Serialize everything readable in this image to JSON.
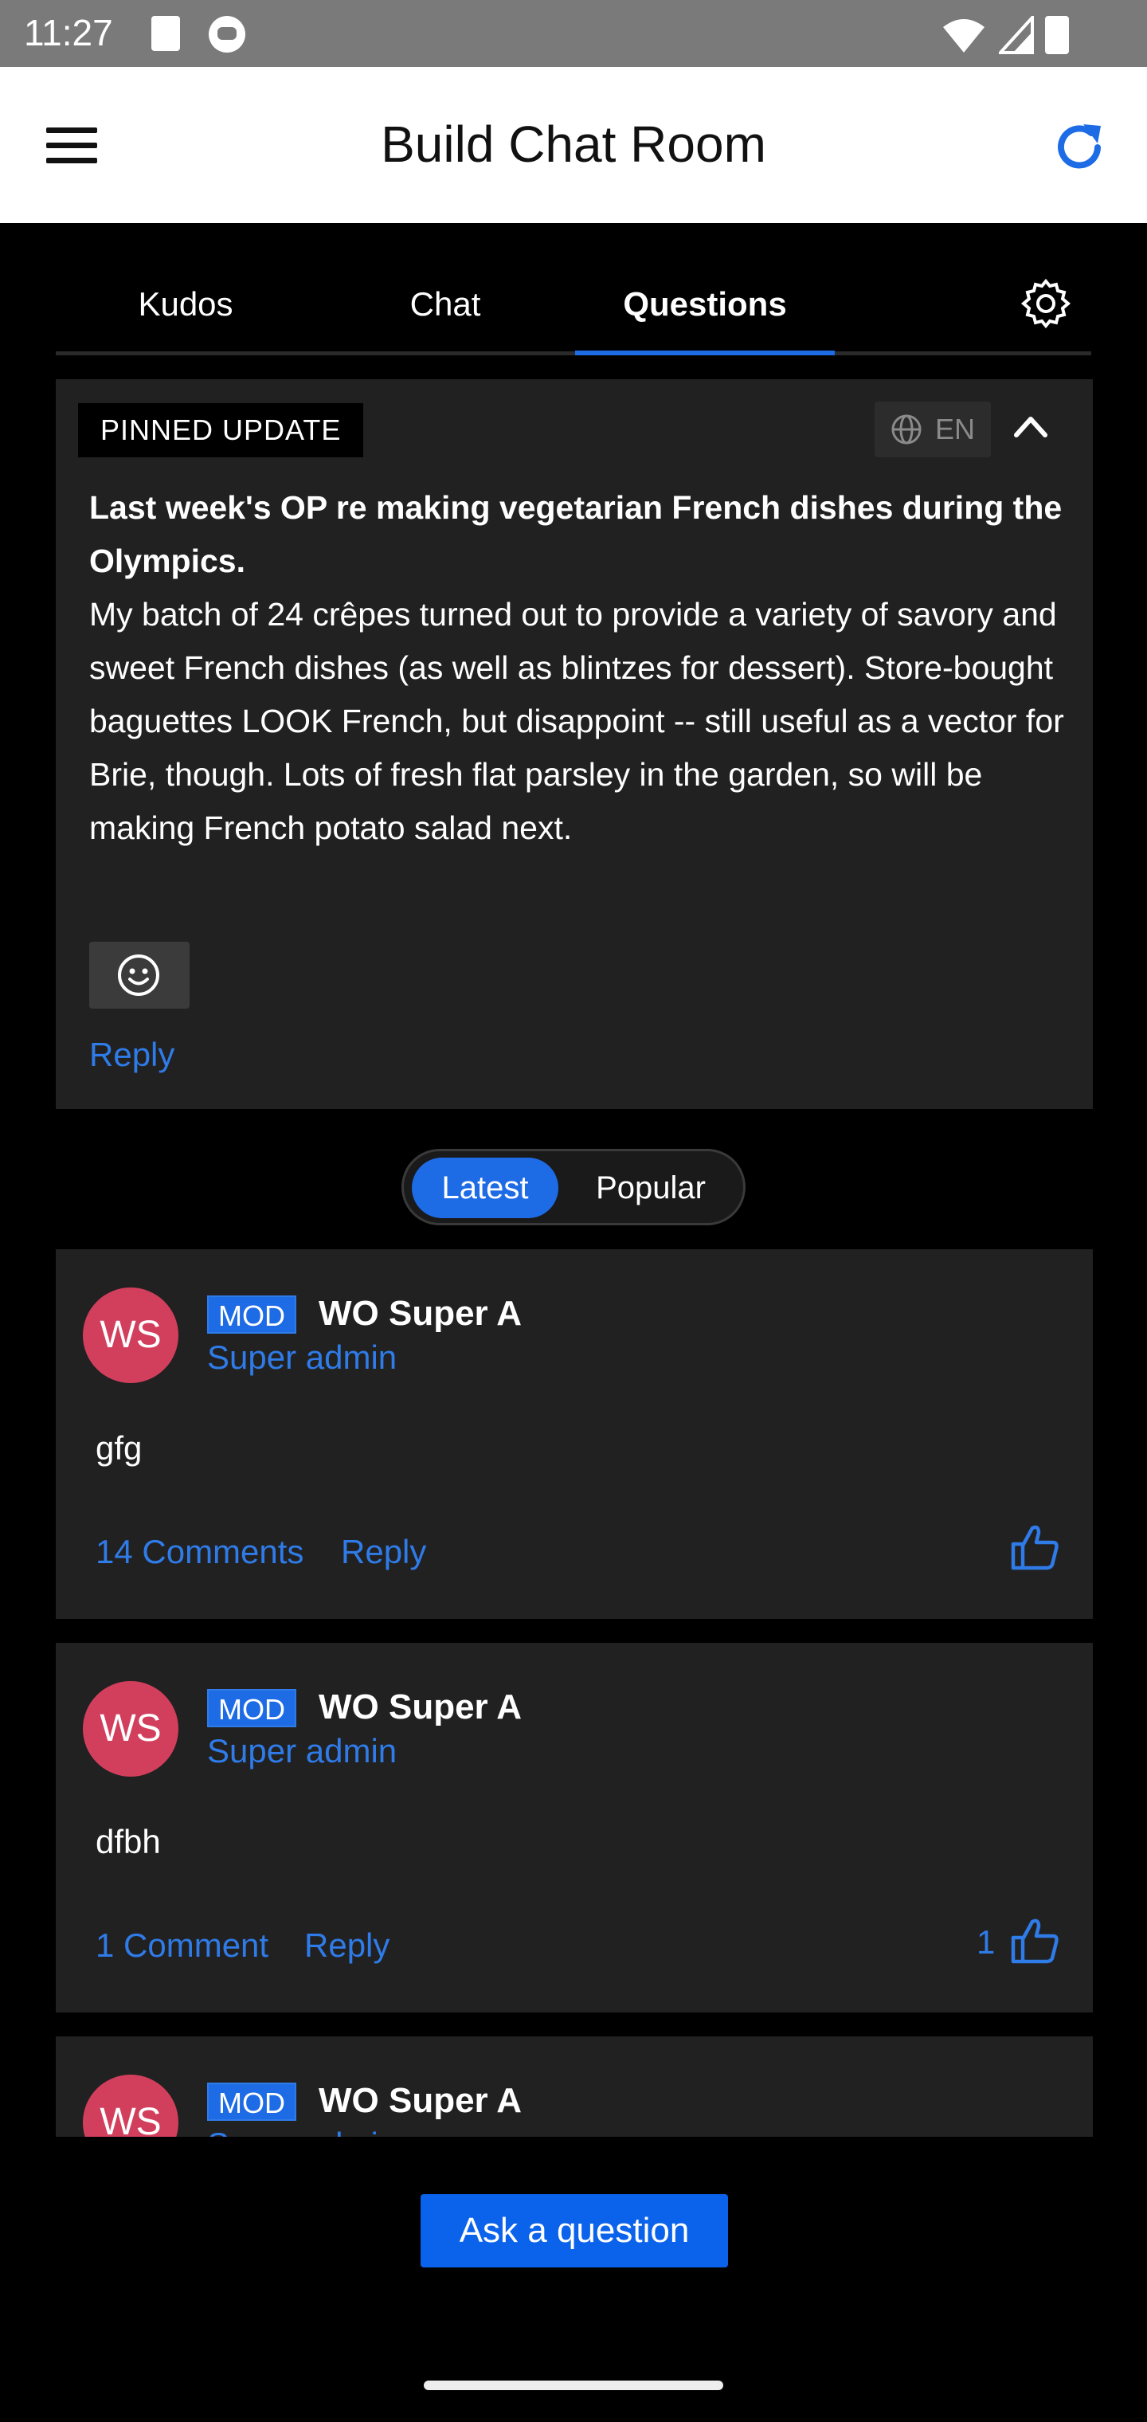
{
  "status_bar": {
    "time": "11:27",
    "icons": [
      "sd-card-icon",
      "cat-icon",
      "wifi-icon",
      "signal-icon",
      "battery-icon"
    ]
  },
  "app_bar": {
    "title": "Build Chat Room",
    "menu_icon": "menu-icon",
    "refresh_icon": "refresh-icon",
    "accent_color": "#1e6be6"
  },
  "tabs": [
    {
      "label": "Kudos",
      "active": false
    },
    {
      "label": "Chat",
      "active": false
    },
    {
      "label": "Questions",
      "active": true
    }
  ],
  "pinned": {
    "badge": "PINNED UPDATE",
    "language": "EN",
    "title": "Last week's OP re making vegetarian French dishes during the Olympics.",
    "body": "My batch of 24 crêpes turned out to provide a variety of savory and sweet French dishes (as well as blintzes for dessert). Store-bought baguettes LOOK French, but disappoint -- still useful as a vector for Brie, though. Lots of fresh flat parsley in the garden, so will be making French potato salad next.",
    "reply_label": "Reply"
  },
  "sort": {
    "options": [
      "Latest",
      "Popular"
    ],
    "selected": "Latest"
  },
  "questions": [
    {
      "initials": "WS",
      "mod_badge": "MOD",
      "author": "WO Super A",
      "role": "Super admin",
      "text": "gfg",
      "comments_label": "14 Comments",
      "reply_label": "Reply",
      "likes": ""
    },
    {
      "initials": "WS",
      "mod_badge": "MOD",
      "author": "WO Super A",
      "role": "Super admin",
      "text": "dfbh",
      "comments_label": "1 Comment",
      "reply_label": "Reply",
      "likes": "1"
    },
    {
      "initials": "WS",
      "mod_badge": "MOD",
      "author": "WO Super A",
      "role": "Super admin",
      "text": "",
      "comments_label": "",
      "reply_label": "",
      "likes": ""
    }
  ],
  "ask_button": "Ask a question",
  "colors": {
    "avatar": "#d23f5c",
    "link": "#2f7be8",
    "card": "#212121",
    "primary_button": "#0b63ec"
  }
}
